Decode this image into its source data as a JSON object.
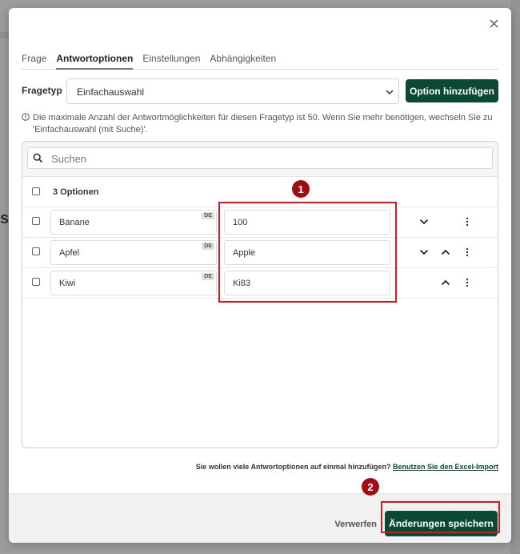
{
  "background": {
    "partial_text": "ss"
  },
  "modal": {
    "tabs": [
      {
        "label": "Frage",
        "active": false
      },
      {
        "label": "Antwortoptionen",
        "active": true
      },
      {
        "label": "Einstellungen",
        "active": false
      },
      {
        "label": "Abhängigkeiten",
        "active": false
      }
    ],
    "fragetyp": {
      "label": "Fragetyp",
      "value": "Einfachauswahl"
    },
    "add_option_label": "Option hinzufügen",
    "info_text": "Die maximale Anzahl der Antwortmöglichkeiten für diesen Fragetyp ist 50. Wenn Sie mehr benötigen, wechseln Sie zu 'Einfachauswahl (mit Suche)'.",
    "search": {
      "placeholder": "Suchen"
    },
    "options_header": "3 Optionen",
    "language_badge": "DE",
    "options": [
      {
        "label": "Banane",
        "value": "100"
      },
      {
        "label": "Apfel",
        "value": "Apple"
      },
      {
        "label": "Kiwi",
        "value": "Ki83"
      }
    ],
    "excel_note": {
      "text": "Sie wollen viele Antwortoptionen auf einmal hinzufügen?",
      "link": "Benutzen Sie den Excel-Import"
    },
    "footer": {
      "discard_label": "Verwerfen",
      "save_label": "Änderungen speichern"
    }
  },
  "annotations": {
    "marker1": "1",
    "marker2": "2"
  },
  "colors": {
    "primary": "#0b4a32",
    "highlight": "#d9171f",
    "marker": "#a10d12"
  }
}
